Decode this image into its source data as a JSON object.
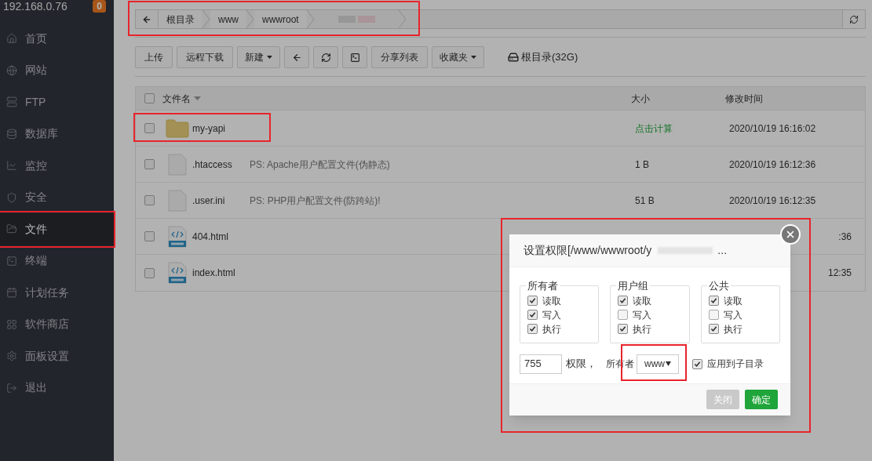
{
  "sidebar": {
    "host": "192.168.0.76",
    "badge": "0",
    "items": [
      {
        "label": "首页",
        "selected": false,
        "highlighted": false
      },
      {
        "label": "网站",
        "selected": false,
        "highlighted": false
      },
      {
        "label": "FTP",
        "selected": false,
        "highlighted": false
      },
      {
        "label": "数据库",
        "selected": false,
        "highlighted": false
      },
      {
        "label": "监控",
        "selected": false,
        "highlighted": false
      },
      {
        "label": "安全",
        "selected": false,
        "highlighted": false
      },
      {
        "label": "文件",
        "selected": true,
        "highlighted": true
      },
      {
        "label": "终端",
        "selected": false,
        "highlighted": false
      },
      {
        "label": "计划任务",
        "selected": false,
        "highlighted": false
      },
      {
        "label": "软件商店",
        "selected": false,
        "highlighted": false
      },
      {
        "label": "面板设置",
        "selected": false,
        "highlighted": false
      },
      {
        "label": "退出",
        "selected": false,
        "highlighted": false
      }
    ]
  },
  "breadcrumb": {
    "highlighted": true,
    "segments": [
      {
        "kind": "text",
        "label": "根目录"
      },
      {
        "kind": "text",
        "label": "www"
      },
      {
        "kind": "text",
        "label": "wwwroot"
      },
      {
        "kind": "redacted"
      }
    ]
  },
  "toolbar": {
    "buttons": [
      {
        "kind": "text",
        "label": "上传"
      },
      {
        "kind": "text",
        "label": "远程下载"
      },
      {
        "kind": "dropdown",
        "label": "新建"
      },
      {
        "kind": "icon"
      },
      {
        "kind": "icon"
      },
      {
        "kind": "icon"
      },
      {
        "kind": "text",
        "label": "分享列表"
      },
      {
        "kind": "dropdown",
        "label": "收藏夹"
      }
    ],
    "disk": "根目录(32G)"
  },
  "table": {
    "header_checked": false,
    "columns": [
      "文件名",
      "大小",
      "修改时间"
    ],
    "rows": [
      {
        "kind": "folder",
        "name": "my-yapi",
        "note": "",
        "size": "点击计算",
        "size_is_action": true,
        "modified": "2020/10/19 16:16:02",
        "checked": false,
        "highlighted": true
      },
      {
        "kind": "file",
        "name": ".htaccess",
        "note": "PS: Apache用户配置文件(伪静态)",
        "size": "1 B",
        "size_is_action": false,
        "modified": "2020/10/19 16:12:36",
        "checked": false,
        "highlighted": false
      },
      {
        "kind": "file",
        "name": ".user.ini",
        "note": "PS: PHP用户配置文件(防跨站)!",
        "size": "51 B",
        "size_is_action": false,
        "modified": "2020/10/19 16:12:35",
        "checked": false,
        "highlighted": false
      },
      {
        "kind": "html",
        "name": "404.html",
        "note": "",
        "modified": ":36",
        "checked": false,
        "highlighted": false
      },
      {
        "kind": "html",
        "name": "index.html",
        "note": "",
        "modified": "12:35",
        "checked": false,
        "highlighted": false
      }
    ]
  },
  "dialog": {
    "highlighted": true,
    "title": "设置权限[/www/wwwroot/y",
    "title_end": "...",
    "groups": [
      {
        "label": "所有者",
        "options": [
          {
            "label": "读取",
            "checked": true
          },
          {
            "label": "写入",
            "checked": true
          },
          {
            "label": "执行",
            "checked": true
          }
        ]
      },
      {
        "label": "用户组",
        "options": [
          {
            "label": "读取",
            "checked": true
          },
          {
            "label": "写入",
            "checked": false
          },
          {
            "label": "执行",
            "checked": true
          }
        ]
      },
      {
        "label": "公共",
        "options": [
          {
            "label": "读取",
            "checked": true
          },
          {
            "label": "写入",
            "checked": false
          },
          {
            "label": "执行",
            "checked": true
          }
        ]
      }
    ],
    "mode": "755",
    "mode_label": "权限，",
    "owner_label": "所有者",
    "owner": {
      "value": "www",
      "highlighted": true
    },
    "recursive": {
      "label": "应用到子目录",
      "checked": true
    },
    "buttons": [
      {
        "kind": "secondary",
        "label": "关闭"
      },
      {
        "kind": "primary",
        "label": "确定"
      }
    ]
  }
}
